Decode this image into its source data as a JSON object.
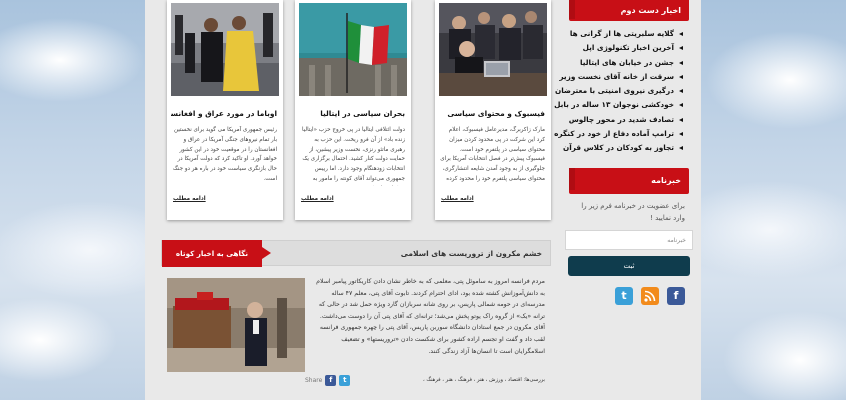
{
  "handpicked": {
    "title": "اخبار دست دوم",
    "items": [
      "گلایه سلبریتی ها از گرانی ها",
      "آخرین اخبار تکنولوژی اپل",
      "جشن در خیابان های ایتالیا",
      "سرقت از خانه آقای نخست وزیر",
      "درگیری نیروی امنیتی با معترضان",
      "خودکشی نوجوان ۱۳ ساله در بابل",
      "تصادف شدید در محور چالوس",
      "ترامپ آماده دفاع از خود در کنگره",
      "تجاوز به کودکان در کلاس قرآن"
    ]
  },
  "newsletter": {
    "title": "خبرنامه",
    "description": "برای عضویت در خبرنامه فرم زیر را وارد نمایید !",
    "placeholder": "خبرنامه",
    "submit_label": "ثبت"
  },
  "social": {
    "twitter": "t",
    "rss": "rss",
    "facebook": "f"
  },
  "cards": [
    {
      "title": "فیسبوک و محتوای سیاسی",
      "body": "مارک زاکربرگ، مدیرعامل فیسبوک، اعلام کرد این شرکت در پی محدود کردن میزان محتوای سیاسی در پلتفرم خود است. فیسبوک پیش‌تر در فصل انتخابات آمریکا برای جلوگیری از به وجود آمدن شایعه انتشار‌گری، محتوای سیاسی پلتفرم خود را محدود کرده بود.",
      "more": "ادامه مطلب"
    },
    {
      "title": "بحران سیاسی در ایتالیا",
      "body": "دولت ائتلافی ایتالیا در پی خروج حزب «ایتالیا زنده باد» از آن فرو ریخت. این حزب به رهبری ماتئو رنزی، نخست وزیر پیشین، از حمایت دولت کنار کشید. احتمال برگزاری یک انتخابات زودهنگام وجود دارد. اما رییس جمهوری می‌تواند آقای کونته را مامور به تشکیل دولت کند.",
      "more": "ادامه مطلب"
    },
    {
      "title": "اوباما در مورد عراق و افغانستان",
      "body": "رئیس جمهوری آمریکا می گوید برای نخستین بار تمام نیروهای جنگی آمریکا در عراق و افغانستان را در موقعیت خود در این کشور خواهد آورد. او تاکید کرد که دولت آمریکا در حال بازنگری سیاست خود در باره هر دو جنگ است.",
      "more": "ادامه مطلب"
    }
  ],
  "short_news": {
    "tab_label": "نگاهی به اخبار کوتاه",
    "title": "خشم مکرون از تروریست های اسلامی",
    "text": "مردم فرانسه امروز به ساموئل پتی، معلمی که به خاطر نشان دادن کاریکاتور پیامبر اسلام به دانش‌آموزانش کشته شده بود، ادای احترام کردند. تابوت آقای پتی، معلم ۴۷ ساله مدرسه‌ای در حومه شمالی پاریس، بر روی شانه سربازان گارد ویژه حمل شد در حالی که ترانه «یک» از گروه راک یو‌تو پخش می‌شد؛ ترانه‌ای که آقای پتی آن را دوست می‌داشت. آقای مکرون در جمع استادان دانشگاه سوربن پاریس، آقای پتی را چهره جمهوری فرانسه لقب داد و گفت او تجسم اراده کشور برای شکست دادن «تروریستها» و تضعیف اسلامگرایان است تا انسان‌ها آزاد زندگی کنند.",
    "tags": "بررسی‌ها: اقتصاد ، ورزش ، هنر ، فرهنگ ، هنر ، فرهنگ ،",
    "share_label": "Share"
  }
}
